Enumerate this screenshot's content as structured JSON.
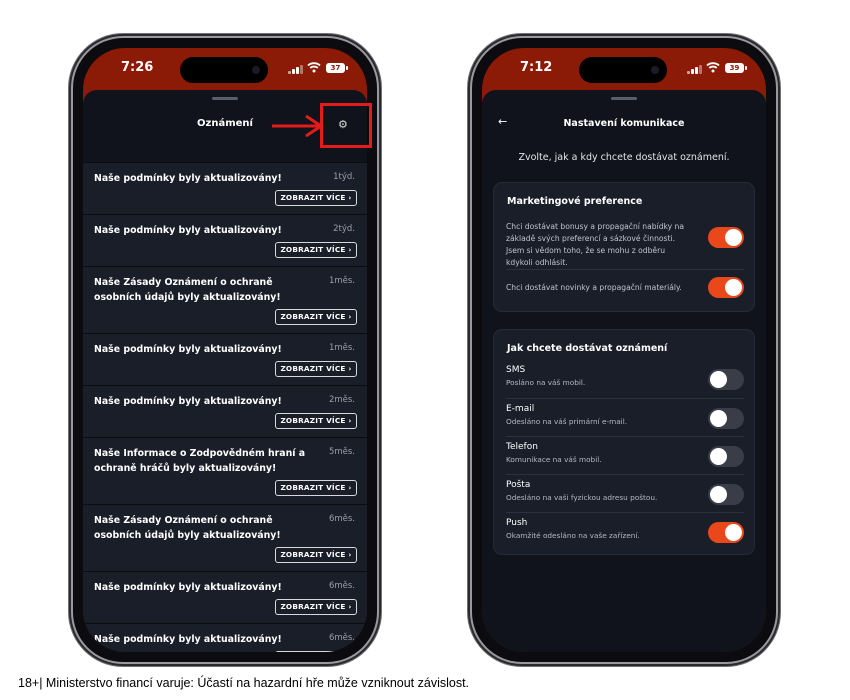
{
  "left_phone": {
    "status": {
      "time": "7:26",
      "battery": "37"
    },
    "header": {
      "title": "Oznámení",
      "settings_icon": "gear-icon"
    },
    "notifications": [
      {
        "text": "Naše podmínky byly aktualizovány!",
        "ago": "1týd.",
        "button": "ZOBRAZIT VÍCE"
      },
      {
        "text": "Naše podmínky byly aktualizovány!",
        "ago": "2týd.",
        "button": "ZOBRAZIT VÍCE"
      },
      {
        "text": "Naše Zásady Oznámení o ochraně osobních údajů byly aktualizovány!",
        "ago": "1měs.",
        "button": "ZOBRAZIT VÍCE"
      },
      {
        "text": "Naše podmínky byly aktualizovány!",
        "ago": "1měs.",
        "button": "ZOBRAZIT VÍCE"
      },
      {
        "text": "Naše podmínky byly aktualizovány!",
        "ago": "2měs.",
        "button": "ZOBRAZIT VÍCE"
      },
      {
        "text": "Naše Informace o Zodpovědném hraní a ochraně hráčů byly aktualizovány!",
        "ago": "5měs.",
        "button": "ZOBRAZIT VÍCE"
      },
      {
        "text": "Naše Zásady Oznámení o ochraně osobních údajů byly aktualizovány!",
        "ago": "6měs.",
        "button": "ZOBRAZIT VÍCE"
      },
      {
        "text": "Naše podmínky byly aktualizovány!",
        "ago": "6měs.",
        "button": "ZOBRAZIT VÍCE"
      },
      {
        "text": "Naše podmínky byly aktualizovány!",
        "ago": "6měs.",
        "button": "ZOBRAZIT VÍCE"
      }
    ]
  },
  "right_phone": {
    "status": {
      "time": "7:12",
      "battery": "39"
    },
    "header": {
      "title": "Nastavení komunikace",
      "back_icon": "back-arrow-icon"
    },
    "intro": "Zvolte, jak a kdy chcete dostávat oznámení.",
    "marketing": {
      "title": "Marketingové preference",
      "items": [
        {
          "text": "Chci dostávat bonusy a propagační nabídky na základě svých preferencí a sázkové činnosti. Jsem si vědom toho, že se mohu z odběru kdykoli odhlásit.",
          "on": true
        },
        {
          "text": "Chci dostávat novinky a propagační materiály.",
          "on": true
        }
      ]
    },
    "channels": {
      "title": "Jak chcete dostávat oznámení",
      "items": [
        {
          "name": "SMS",
          "sub": "Posláno na váš mobil.",
          "on": false
        },
        {
          "name": "E-mail",
          "sub": "Odesláno na váš primární e-mail.",
          "on": false
        },
        {
          "name": "Telefon",
          "sub": "Komunikace na váš mobil.",
          "on": false
        },
        {
          "name": "Pošta",
          "sub": "Odesláno na vaši fyzickou adresu poštou.",
          "on": false
        },
        {
          "name": "Push",
          "sub": "Okamžité odesláno na vaše zařízení.",
          "on": true
        }
      ]
    }
  },
  "colors": {
    "accent": "#e8481a",
    "annotation": "#e41b1b",
    "status_bar": "#8b1a06",
    "sheet": "#10131c",
    "card": "#1a1e29"
  },
  "footer": "18+| Ministerstvo financí varuje: Účastí na hazardní hře může vzniknout závislost."
}
